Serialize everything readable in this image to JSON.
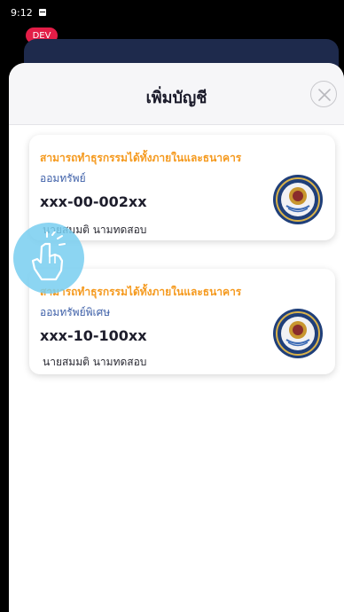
{
  "status_bar": {
    "time": "9:12",
    "notification_icon": "notification-icon"
  },
  "badge": {
    "label": "DEV",
    "color": "#e31d47"
  },
  "sheet": {
    "title": "เพิ่มบัญชี",
    "close_icon": "close-icon"
  },
  "accounts": [
    {
      "status": "สามารถทำธุรกรรมได้ทั้งภายในและธนาคาร",
      "type": "ออมทรัพย์",
      "number": "xxx-00-002xx",
      "owner": "นายสมมติ นามทดสอบ",
      "logo_icon": "bank-seal-icon"
    },
    {
      "status": "สามารถทำธุรกรรมได้ทั้งภายในและธนาคาร",
      "type": "ออมทรัพย์พิเศษ",
      "number": "xxx-10-100xx",
      "owner": "นายสมมติ นามทดสอบ",
      "logo_icon": "bank-seal-icon"
    }
  ],
  "touch_indicator": {
    "icon": "tap-hand-icon"
  },
  "colors": {
    "accent_orange": "#f59a1f",
    "type_blue": "#3d5fa8",
    "header_navy": "#1e2a4c",
    "touch_blue": "#78cef0"
  }
}
